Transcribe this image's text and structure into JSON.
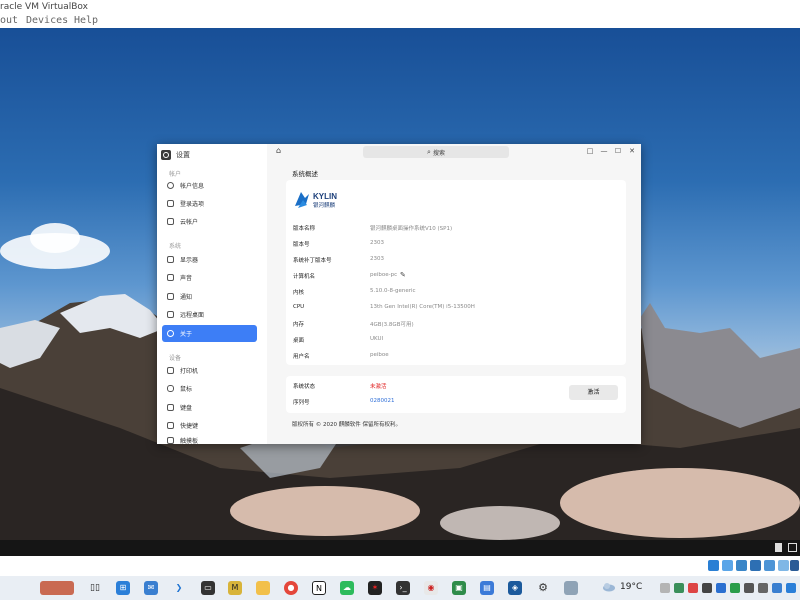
{
  "vbox": {
    "title": "racle VM VirtualBox",
    "menu": {
      "about": "out",
      "devices": "Devices",
      "help": "Help"
    }
  },
  "settings": {
    "app_title": "设置",
    "search_placeholder": "搜索",
    "window_buttons": [
      "□",
      "—",
      "☐",
      "✕"
    ],
    "sidebar": {
      "section_account": "帐户",
      "account_items": [
        "帐户信息",
        "登录选项",
        "云帐户"
      ],
      "section_system": "系统",
      "system_items": [
        "显示器",
        "声音",
        "通知",
        "远程桌面",
        "关于"
      ],
      "section_devices": "设备",
      "device_items": [
        "打印机",
        "鼠标",
        "键盘",
        "快捷键",
        "触摸板"
      ]
    },
    "page": {
      "heading": "系统概述",
      "logo_text_latin": "KYLIN",
      "logo_text_cn": "银河麒麟",
      "rows": [
        {
          "key": "版本名称",
          "value": "银河麒麟桌面操作系统V10 (SP1)"
        },
        {
          "key": "版本号",
          "value": "2303"
        },
        {
          "key": "系统补丁版本号",
          "value": "2303"
        },
        {
          "key": "计算机名",
          "value": "peiboe-pc"
        },
        {
          "key": "内核",
          "value": "5.10.0-8-generic"
        },
        {
          "key": "CPU",
          "value": "13th Gen Intel(R) Core(TM) i5-13500H"
        },
        {
          "key": "内存",
          "value": "4GB(3.8GB可用)"
        },
        {
          "key": "桌面",
          "value": "UKUI"
        },
        {
          "key": "用户名",
          "value": "peiboe"
        }
      ],
      "status_label": "系统状态",
      "status_value": "未激活",
      "serial_label": "序列号",
      "serial_value": "0280021",
      "activate_label": "激活",
      "copyright": "版权所有 © 2020 麒麟软件 保留所有权利。"
    }
  },
  "taskbar": {
    "weather_temp": "19°C"
  },
  "colors": {
    "accent": "#3d7ef6",
    "status_inactive": "#e02020",
    "serial_link": "#2f6fd8"
  }
}
